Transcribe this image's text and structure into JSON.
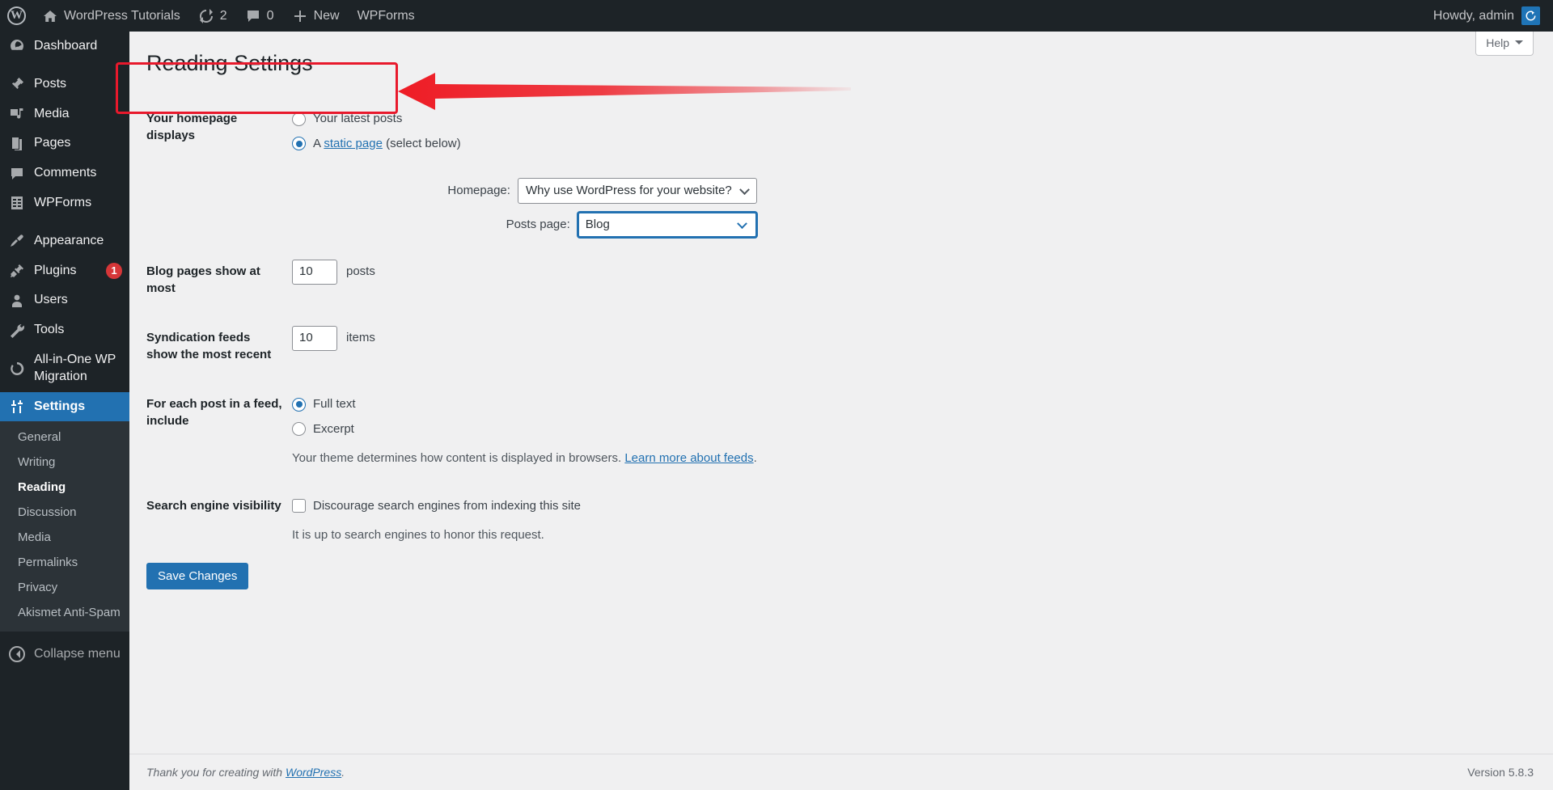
{
  "adminbar": {
    "logo_icon": "wordpress-logo-icon",
    "site_name": "WordPress Tutorials",
    "updates_icon": "updates-icon",
    "updates_count": "2",
    "comments_icon": "comment-bubble-icon",
    "comments_count": "0",
    "new_icon": "plus-icon",
    "new_label": "New",
    "wpforms_label": "WPForms",
    "howdy": "Howdy, admin",
    "avatar_icon": "user-avatar-icon"
  },
  "sidebar": {
    "items": [
      {
        "label": "Dashboard",
        "icon": "dashboard-icon",
        "current": false
      },
      {
        "label": "Posts",
        "icon": "pin-icon",
        "current": false
      },
      {
        "label": "Media",
        "icon": "media-icon",
        "current": false
      },
      {
        "label": "Pages",
        "icon": "pages-icon",
        "current": false
      },
      {
        "label": "Comments",
        "icon": "comment-bubble-icon",
        "current": false
      },
      {
        "label": "WPForms",
        "icon": "wpforms-icon",
        "current": false
      },
      {
        "label": "Appearance",
        "icon": "paintbrush-icon",
        "current": false
      },
      {
        "label": "Plugins",
        "icon": "plug-icon",
        "current": false,
        "badge": "1"
      },
      {
        "label": "Users",
        "icon": "user-icon",
        "current": false
      },
      {
        "label": "Tools",
        "icon": "wrench-icon",
        "current": false
      },
      {
        "label": "All-in-One WP Migration",
        "icon": "migration-icon",
        "current": false
      },
      {
        "label": "Settings",
        "icon": "settings-sliders-icon",
        "current": true
      }
    ],
    "submenu": [
      {
        "label": "General",
        "current": false
      },
      {
        "label": "Writing",
        "current": false
      },
      {
        "label": "Reading",
        "current": true
      },
      {
        "label": "Discussion",
        "current": false
      },
      {
        "label": "Media",
        "current": false
      },
      {
        "label": "Permalinks",
        "current": false
      },
      {
        "label": "Privacy",
        "current": false
      },
      {
        "label": "Akismet Anti-Spam",
        "current": false
      }
    ],
    "collapse_label": "Collapse menu",
    "collapse_icon": "collapse-arrow-icon"
  },
  "help_tab": {
    "label": "Help",
    "icon": "chevron-down-icon"
  },
  "page": {
    "title": "Reading Settings",
    "homepage_displays": {
      "label": "Your homepage displays",
      "option_latest": "Your latest posts",
      "option_static_prefix": "A ",
      "option_static_link": "static page",
      "option_static_suffix": " (select below)",
      "selected": "static"
    },
    "homepage_select": {
      "label": "Homepage:",
      "value": "Why use WordPress for your website?"
    },
    "posts_page_select": {
      "label": "Posts page:",
      "value": "Blog",
      "focused": true
    },
    "blog_pages": {
      "label": "Blog pages show at most",
      "value": "10",
      "unit": "posts"
    },
    "syndication": {
      "label": "Syndication feeds show the most recent",
      "value": "10",
      "unit": "items"
    },
    "feed_include": {
      "label": "For each post in a feed, include",
      "option_full": "Full text",
      "option_excerpt": "Excerpt",
      "selected": "full",
      "description_prefix": "Your theme determines how content is displayed in browsers. ",
      "description_link": "Learn more about feeds",
      "description_suffix": "."
    },
    "search_visibility": {
      "label": "Search engine visibility",
      "checkbox_label": "Discourage search engines from indexing this site",
      "checked": false,
      "note": "It is up to search engines to honor this request."
    },
    "save_label": "Save Changes"
  },
  "footer": {
    "thanks_prefix": "Thank you for creating with ",
    "thanks_link": "WordPress",
    "thanks_suffix": ".",
    "version": "Version 5.8.3"
  },
  "annotation": {
    "highlight_color": "#e8192c",
    "arrow_color": "#ee1c25",
    "arrow_icon": "left-pointing-arrow-icon",
    "highlight_icon": "rectangle-highlight-icon"
  }
}
